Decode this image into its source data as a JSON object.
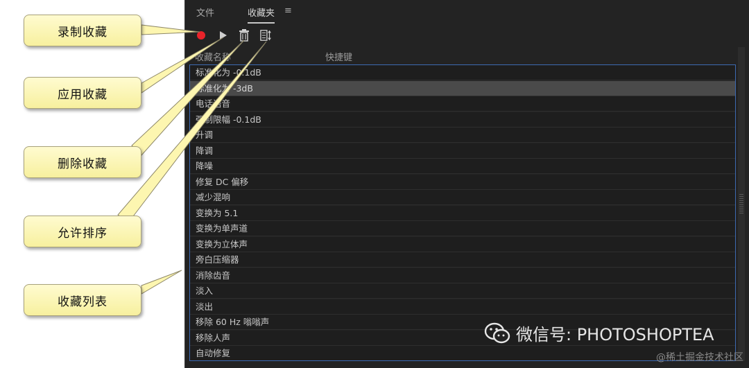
{
  "panel": {
    "tabs": [
      "文件",
      "收藏夹"
    ],
    "tab_menu_glyph": "≡",
    "columns": [
      "收藏名称",
      "快捷键"
    ],
    "favorites": [
      "标准化为 -0.1dB",
      "标准化为 -3dB",
      "电话语音",
      "强制限幅 -0.1dB",
      "升调",
      "降调",
      "降噪",
      "修复 DC 偏移",
      "减少混响",
      "变换为 5.1",
      "变换为单声道",
      "变换为立体声",
      "旁白压缩器",
      "消除齿音",
      "淡入",
      "淡出",
      "移除 60 Hz 嗡嗡声",
      "移除人声",
      "自动修复"
    ],
    "selected_index": 1,
    "toolbar_icons": [
      "record-icon",
      "play-icon",
      "trash-icon",
      "sort-icon"
    ],
    "colors": {
      "record": "#e8232a",
      "selection": "#4a4a4a",
      "focus_border": "#3d6ab3"
    }
  },
  "callouts": [
    "录制收藏",
    "应用收藏",
    "删除收藏",
    "允许排序",
    "收藏列表"
  ],
  "watermark": {
    "text": "微信号: PHOTOSHOPTEA",
    "credit": "@稀土掘金技术社区"
  }
}
